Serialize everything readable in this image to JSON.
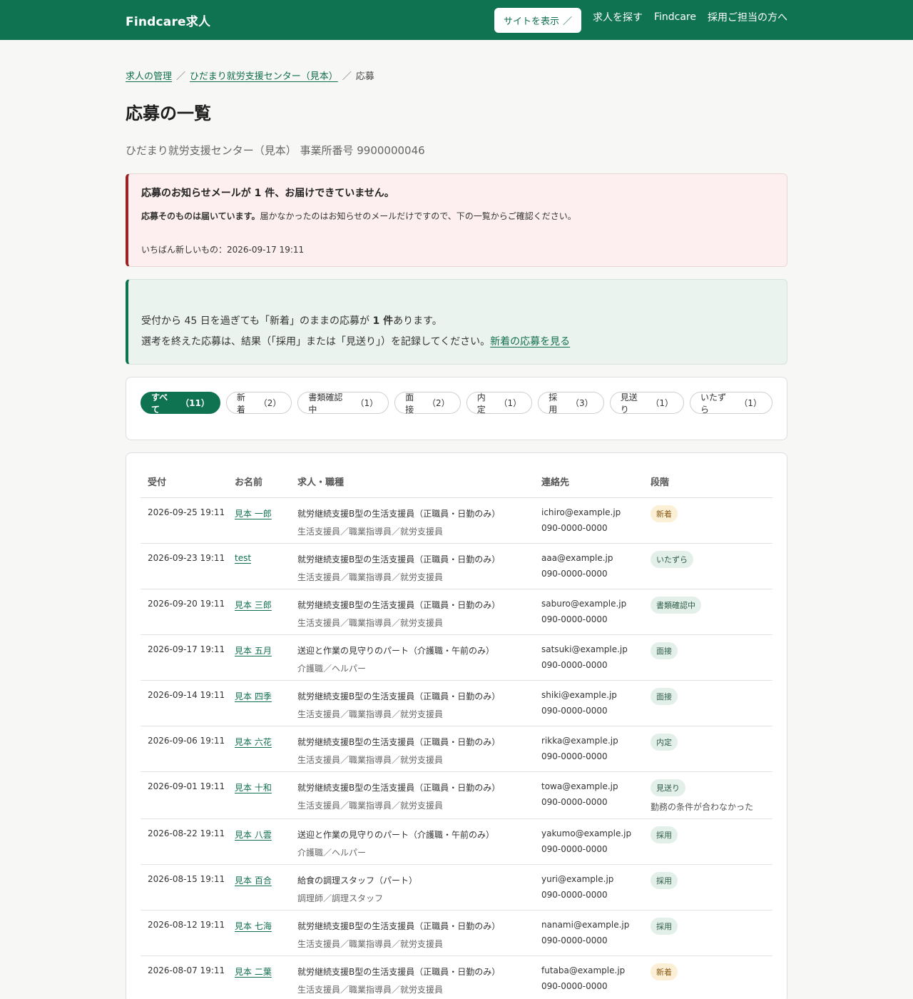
{
  "header": {
    "brand": "Findcare求人",
    "site_button": "サイトを表示",
    "nav": [
      "求人を探す",
      "Findcare",
      "採用ご担当の方へ"
    ]
  },
  "breadcrumb": [
    "求人の管理",
    "ひだまり就労支援センター（見本）",
    "応募"
  ],
  "page_title": "応募の一覧",
  "office_line": "ひだまり就労支援センター（見本） 事業所番号 9900000046",
  "alert": {
    "title": "応募のお知らせメールが 1 件、お届けできていません。",
    "body_bold": "応募そのものは届いています。",
    "body_rest": "届かなかったのはお知らせのメールだけですので、下の一覧からご確認ください。",
    "latest": "いちばん新しいもの：2026-09-17 19:11"
  },
  "notice": {
    "line1_a": "受付から 45 日を過ぎても「新着」のままの応募が ",
    "line1_b": "1 件",
    "line1_c": "あります。",
    "line2": "選考を終えた応募は、結果（「採用」または「見送り」）を記録してください。",
    "link": "新着の応募を見る"
  },
  "filters": [
    {
      "label": "すべて",
      "count": "（11）"
    },
    {
      "label": "新着",
      "count": "（2）"
    },
    {
      "label": "書類確認中",
      "count": "（1）"
    },
    {
      "label": "面接",
      "count": "（2）"
    },
    {
      "label": "内定",
      "count": "（1）"
    },
    {
      "label": "採用",
      "count": "（3）"
    },
    {
      "label": "見送り",
      "count": "（1）"
    },
    {
      "label": "いたずら",
      "count": "（1）"
    }
  ],
  "table": {
    "headers": {
      "date": "受付",
      "name": "お名前",
      "job": "求人・職種",
      "contact": "連絡先",
      "stage": "段階"
    },
    "rows": [
      {
        "date": "2026-09-25 19:11",
        "name": "見本 一郎",
        "job": "就労継続支援B型の生活支援員（正職員・日勤のみ）",
        "job_sub": "生活支援員／職業指導員／就労支援員",
        "email": "ichiro@example.jp",
        "phone": "090-0000-0000",
        "stage": "新着",
        "reason": ""
      },
      {
        "date": "2026-09-23 19:11",
        "name": "test",
        "job": "就労継続支援B型の生活支援員（正職員・日勤のみ）",
        "job_sub": "生活支援員／職業指導員／就労支援員",
        "email": "aaa@example.jp",
        "phone": "090-0000-0000",
        "stage": "いたずら",
        "reason": ""
      },
      {
        "date": "2026-09-20 19:11",
        "name": "見本 三郎",
        "job": "就労継続支援B型の生活支援員（正職員・日勤のみ）",
        "job_sub": "生活支援員／職業指導員／就労支援員",
        "email": "saburo@example.jp",
        "phone": "090-0000-0000",
        "stage": "書類確認中",
        "reason": ""
      },
      {
        "date": "2026-09-17 19:11",
        "name": "見本 五月",
        "job": "送迎と作業の見守りのパート（介護職・午前のみ）",
        "job_sub": "介護職／ヘルパー",
        "email": "satsuki@example.jp",
        "phone": "090-0000-0000",
        "stage": "面接",
        "reason": ""
      },
      {
        "date": "2026-09-14 19:11",
        "name": "見本 四季",
        "job": "就労継続支援B型の生活支援員（正職員・日勤のみ）",
        "job_sub": "生活支援員／職業指導員／就労支援員",
        "email": "shiki@example.jp",
        "phone": "090-0000-0000",
        "stage": "面接",
        "reason": ""
      },
      {
        "date": "2026-09-06 19:11",
        "name": "見本 六花",
        "job": "就労継続支援B型の生活支援員（正職員・日勤のみ）",
        "job_sub": "生活支援員／職業指導員／就労支援員",
        "email": "rikka@example.jp",
        "phone": "090-0000-0000",
        "stage": "内定",
        "reason": ""
      },
      {
        "date": "2026-09-01 19:11",
        "name": "見本 十和",
        "job": "就労継続支援B型の生活支援員（正職員・日勤のみ）",
        "job_sub": "生活支援員／職業指導員／就労支援員",
        "email": "towa@example.jp",
        "phone": "090-0000-0000",
        "stage": "見送り",
        "reason": "勤務の条件が合わなかった"
      },
      {
        "date": "2026-08-22 19:11",
        "name": "見本 八雲",
        "job": "送迎と作業の見守りのパート（介護職・午前のみ）",
        "job_sub": "介護職／ヘルパー",
        "email": "yakumo@example.jp",
        "phone": "090-0000-0000",
        "stage": "採用",
        "reason": ""
      },
      {
        "date": "2026-08-15 19:11",
        "name": "見本 百合",
        "job": "給食の調理スタッフ（パート）",
        "job_sub": "調理師／調理スタッフ",
        "email": "yuri@example.jp",
        "phone": "090-0000-0000",
        "stage": "採用",
        "reason": ""
      },
      {
        "date": "2026-08-12 19:11",
        "name": "見本 七海",
        "job": "就労継続支援B型の生活支援員（正職員・日勤のみ）",
        "job_sub": "生活支援員／職業指導員／就労支援員",
        "email": "nanami@example.jp",
        "phone": "090-0000-0000",
        "stage": "採用",
        "reason": ""
      },
      {
        "date": "2026-08-07 19:11",
        "name": "見本 二葉",
        "job": "就労継続支援B型の生活支援員（正職員・日勤のみ）",
        "job_sub": "生活支援員／職業指導員／就労支援員",
        "email": "futaba@example.jp",
        "phone": "090-0000-0000",
        "stage": "新着",
        "reason": ""
      }
    ]
  },
  "colors": {
    "brand": "#0f7352",
    "alert_border": "#9b2323",
    "badge_new_bg": "#fbefd6",
    "badge_bg": "#e3efe9"
  }
}
